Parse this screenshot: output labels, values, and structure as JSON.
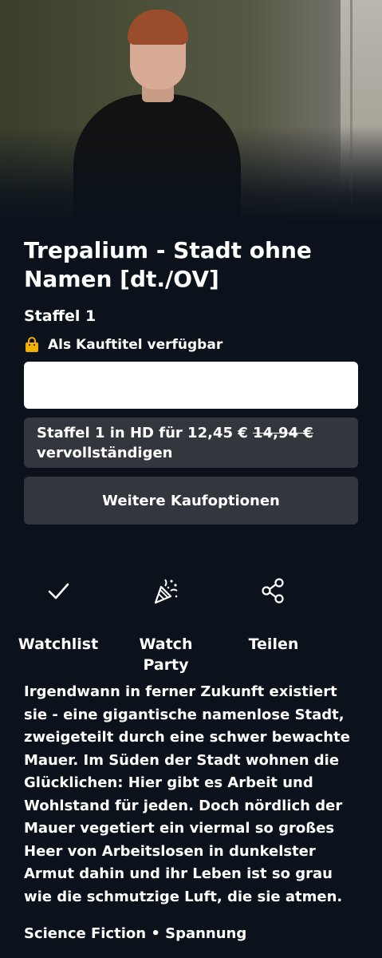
{
  "title": "Trepalium - Stadt ohne Namen [dt./OV]",
  "season": "Staffel 1",
  "availability": {
    "icon": "shopping-bag-icon",
    "text": "Als Kauftitel verfügbar"
  },
  "complete_offer": {
    "line1_prefix": "Staffel 1 in HD für 12,45 €",
    "old_price": "14,94 €",
    "line2": "vervollständigen"
  },
  "more_options_label": "Weitere Kaufoptionen",
  "actions": [
    {
      "icon": "checkmark-icon",
      "label": "Watchlist"
    },
    {
      "icon": "party-popper-icon",
      "label": "Watch Party"
    },
    {
      "icon": "share-icon",
      "label": "Teilen"
    }
  ],
  "description": "Irgendwann in ferner Zukunft existiert sie - eine gigantische namenlose Stadt, zweigeteilt durch eine schwer bewachte Mauer. Im Süden der Stadt wohnen die Glücklichen: Hier gibt es Arbeit und Wohlstand für jeden. Doch nördlich der Mauer vegetiert ein viermal so großes Heer von Arbeitslosen in dunkelster Armut dahin und ihr Leben ist so grau wie die schmutzige Luft, die sie atmen.",
  "genres": "Science Fiction • Spannung",
  "colors": {
    "background": "#0b121b",
    "button": "#33373d",
    "accent_bag": "#f2b100"
  }
}
